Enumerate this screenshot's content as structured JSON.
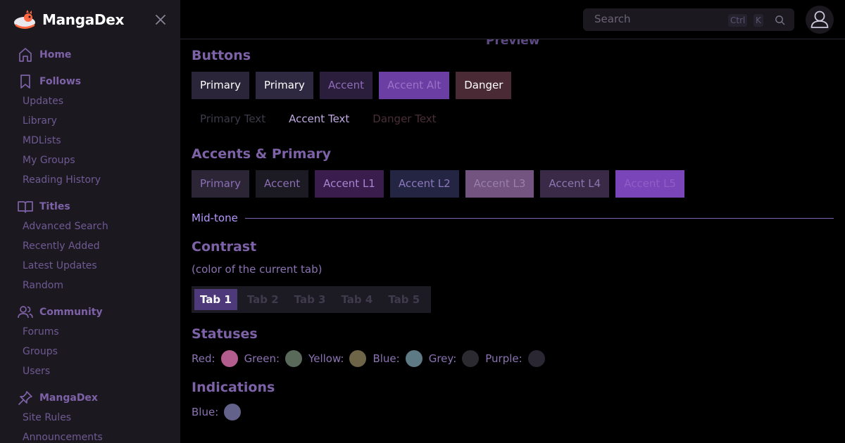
{
  "brand": {
    "name": "MangaDex"
  },
  "sidebar": {
    "sections": [
      {
        "label": "Home",
        "icon": "home-icon",
        "links": []
      },
      {
        "label": "Follows",
        "icon": "bookmark-icon",
        "links": [
          "Updates",
          "Library",
          "MDLists",
          "My Groups",
          "Reading History"
        ]
      },
      {
        "label": "Titles",
        "icon": "book-open-icon",
        "links": [
          "Advanced Search",
          "Recently Added",
          "Latest Updates",
          "Random"
        ]
      },
      {
        "label": "Community",
        "icon": "users-icon",
        "links": [
          "Forums",
          "Groups",
          "Users"
        ]
      },
      {
        "label": "MangaDex",
        "icon": "pin-icon",
        "links": [
          "Site Rules",
          "Announcements"
        ]
      }
    ]
  },
  "topbar": {
    "search_placeholder": "Search",
    "shortcut_ctrl": "Ctrl",
    "shortcut_key": "K"
  },
  "main": {
    "preview_heading": "Preview",
    "buttons_heading": "Buttons",
    "buttons": [
      {
        "label": "Primary",
        "bg": "#2a2538",
        "color": "#ffffff"
      },
      {
        "label": "Primary",
        "bg": "#2e2840",
        "color": "#ffffff"
      },
      {
        "label": "Accent",
        "bg": "#2b1d3c",
        "color": "#8e6db8"
      },
      {
        "label": "Accent Alt",
        "bg": "#6a3ea2",
        "color": "#9a72c8"
      },
      {
        "label": "Danger",
        "bg": "#4a2a34",
        "color": "#ffffff"
      }
    ],
    "text_buttons": [
      {
        "label": "Primary Text",
        "color": "#3e3a4a"
      },
      {
        "label": "Accent Text",
        "color": "#c0a8e0"
      },
      {
        "label": "Danger Text",
        "color": "#4a2e38"
      }
    ],
    "accents_heading": "Accents & Primary",
    "accents": [
      {
        "label": "Primary",
        "bg": "#2c2536",
        "color": "#8c6fb6"
      },
      {
        "label": "Accent",
        "bg": "#1c1a22",
        "color": "#8c6fb6"
      },
      {
        "label": "Accent L1",
        "bg": "#3a1d4c",
        "color": "#a686d0"
      },
      {
        "label": "Accent L2",
        "bg": "#242542",
        "color": "#8c78bf"
      },
      {
        "label": "Accent L3",
        "bg": "#73537f",
        "color": "#9a7fae"
      },
      {
        "label": "Accent L4",
        "bg": "#3a2a48",
        "color": "#8e76b0"
      },
      {
        "label": "Accent L5",
        "bg": "#7a45b8",
        "color": "#8f5fc6"
      }
    ],
    "midtone_label": "Mid-tone",
    "contrast_heading": "Contrast",
    "contrast_note": "(color of the current tab)",
    "tabs": [
      "Tab 1",
      "Tab 2",
      "Tab 3",
      "Tab 4",
      "Tab 5"
    ],
    "statuses_heading": "Statuses",
    "statuses": [
      {
        "label": "Red:",
        "color": "#b35c8e"
      },
      {
        "label": "Green:",
        "color": "#5a6a5a"
      },
      {
        "label": "Yellow:",
        "color": "#6e6548"
      },
      {
        "label": "Blue:",
        "color": "#5e7a84"
      },
      {
        "label": "Grey:",
        "color": "#2b2a30"
      },
      {
        "label": "Purple:",
        "color": "#2a2632"
      }
    ],
    "indications_heading": "Indications",
    "indications": [
      {
        "label": "Blue:",
        "color": "#62628a"
      }
    ]
  }
}
